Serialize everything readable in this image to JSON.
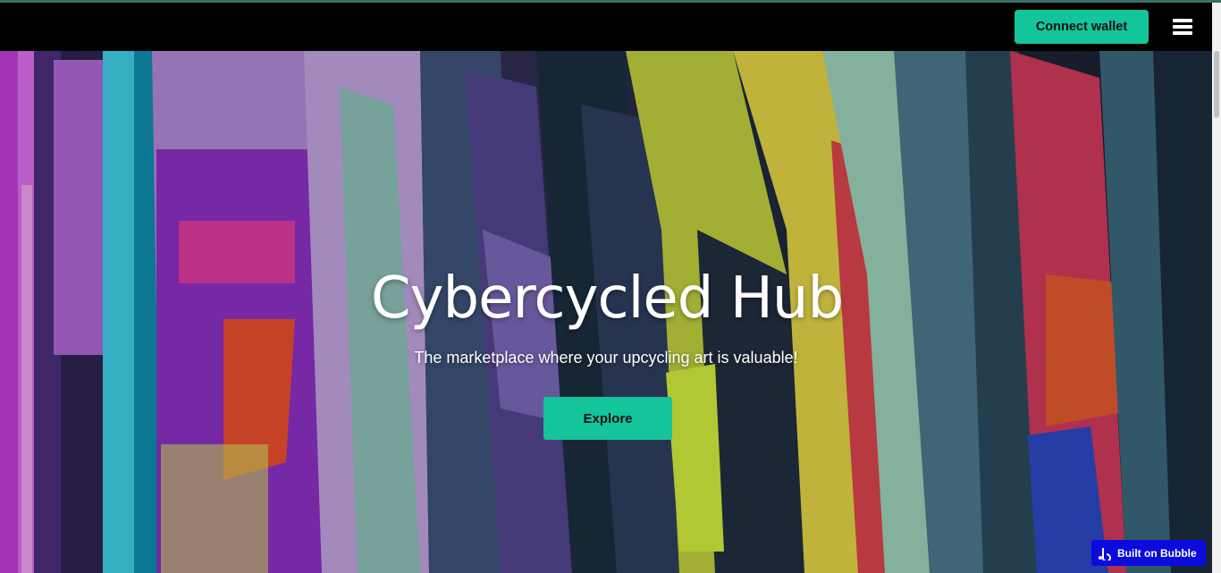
{
  "navbar": {
    "connect_label": "Connect wallet",
    "menu_icon": "hamburger-menu-icon"
  },
  "hero": {
    "title": "Cybercycled Hub",
    "subtitle": "The marketplace where your upcycling art is valuable!",
    "explore_label": "Explore",
    "background_image": "neon clothing rack photo"
  },
  "badge": {
    "label": "Built on Bubble",
    "icon": "bubble-logo-icon"
  },
  "colors": {
    "accent": "#14c49a",
    "navbar_bg": "#000000",
    "badge_bg": "#0a0bdc"
  }
}
